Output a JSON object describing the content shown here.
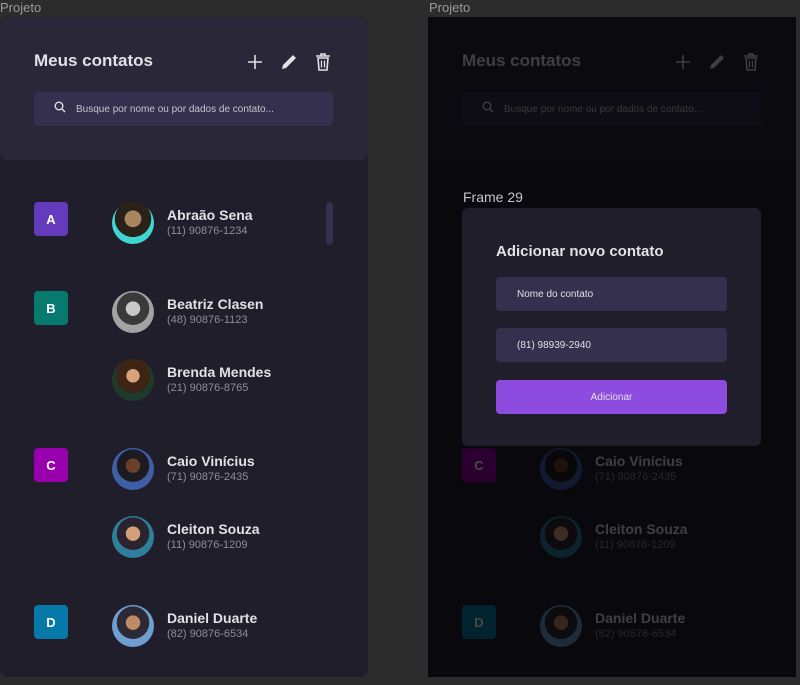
{
  "frames": {
    "left_label": "Projeto",
    "right_label": "Projeto"
  },
  "header": {
    "title": "Meus contatos",
    "add_icon": "plus-icon",
    "edit_icon": "pencil-icon",
    "delete_icon": "trash-icon"
  },
  "search": {
    "placeholder": "Busque por nome ou por dados de contato...",
    "icon": "search-icon"
  },
  "groups": [
    {
      "letter": "A",
      "color": "#633bbc",
      "contacts": [
        {
          "name": "Abraão Sena",
          "phone": "(11) 90876-1234"
        }
      ]
    },
    {
      "letter": "B",
      "color": "#067a6f",
      "contacts": [
        {
          "name": "Beatriz Clasen",
          "phone": "(48) 90876-1123"
        },
        {
          "name": "Brenda Mendes",
          "phone": "(21) 90876-8765"
        }
      ]
    },
    {
      "letter": "C",
      "color": "#9900ad",
      "contacts": [
        {
          "name": "Caio Vinícius",
          "phone": "(71) 90876-2435"
        },
        {
          "name": "Cleiton Souza",
          "phone": "(11) 90876-1209"
        }
      ]
    },
    {
      "letter": "D",
      "color": "#0679a8",
      "contacts": [
        {
          "name": "Daniel Duarte",
          "phone": "(82) 90876-6534"
        }
      ]
    }
  ],
  "overlay": {
    "frame_label": "Frame 29"
  },
  "modal": {
    "title": "Adicionar novo contato",
    "name_field": "Nome do contato",
    "phone_field": "(81) 98939-2940",
    "submit_label": "Adicionar"
  },
  "colors": {
    "accent": "#8e4be0",
    "background": "#201e2b",
    "header": "#292738",
    "input": "#34304d"
  }
}
